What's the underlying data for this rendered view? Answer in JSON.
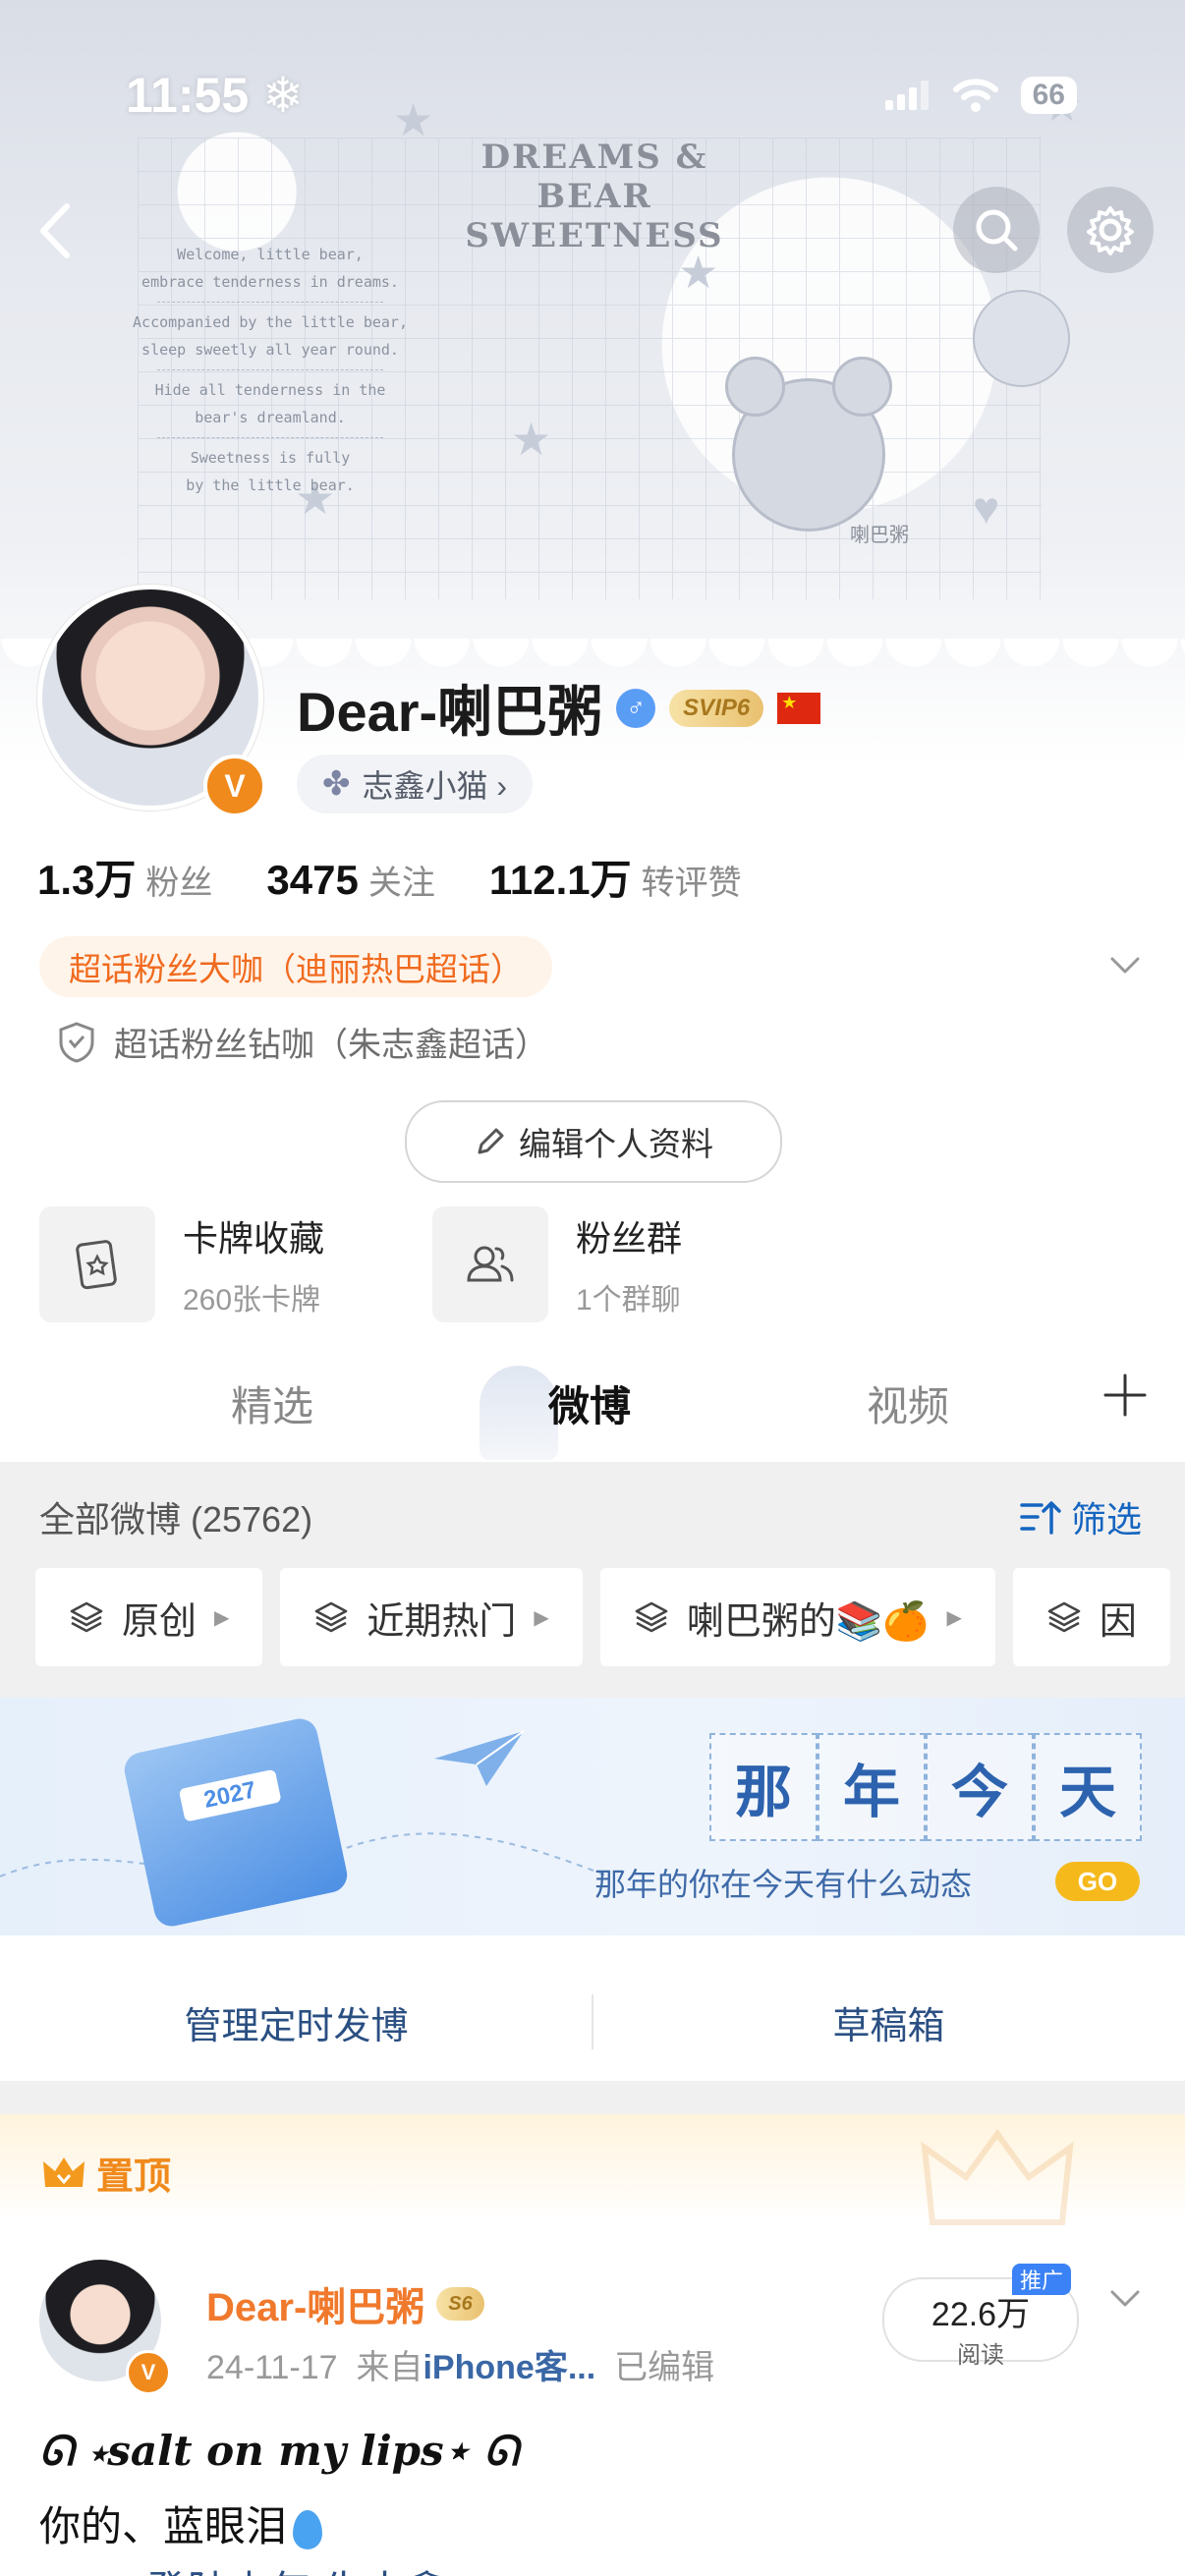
{
  "status_bar": {
    "time": "11:55",
    "battery": "66"
  },
  "banner": {
    "title_line1": "DREAMS & BEAR",
    "title_line2": "SWEETNESS",
    "poem": [
      "Welcome, little bear,",
      "embrace tenderness in dreams.",
      "Accompanied by the little bear,",
      "sleep sweetly all year round.",
      "Hide all tenderness in the",
      "bear's dreamland.",
      "Sweetness is fully",
      "by the little bear."
    ],
    "watermark": "喇巴粥"
  },
  "profile": {
    "name": "Dear-喇巴粥",
    "svip": "SVIP6",
    "tag": "志鑫小猫 ›",
    "stats": [
      {
        "value": "1.3万",
        "label": "粉丝"
      },
      {
        "value": "3475",
        "label": "关注"
      },
      {
        "value": "112.1万",
        "label": "转评赞"
      }
    ],
    "super_fan_orange": "超话粉丝大咖（迪丽热巴超话）",
    "super_fan_plain": "超话粉丝钻咖（朱志鑫超话）",
    "edit_button": "编辑个人资料"
  },
  "features": [
    {
      "title": "卡牌收藏",
      "sub": "260张卡牌"
    },
    {
      "title": "粉丝群",
      "sub": "1个群聊"
    }
  ],
  "tabs": [
    "精选",
    "微博",
    "视频"
  ],
  "feed_header": {
    "all": "全部微博 (25762)",
    "filter": "筛选"
  },
  "chips": [
    "原创",
    "近期热门",
    "喇巴粥的📚🍊",
    "因"
  ],
  "memory": {
    "boxes": [
      "那",
      "年",
      "今",
      "天"
    ],
    "subtitle": "那年的你在今天有什么动态",
    "go": "GO",
    "calendar_year": "2027"
  },
  "manage": {
    "scheduled": "管理定时发博",
    "drafts": "草稿箱"
  },
  "pinned": {
    "label": "置顶",
    "name": "Dear-喇巴粥",
    "badge": "S6",
    "date": "24-11-17",
    "source_prefix": "来自",
    "source": "iPhone客...",
    "edited": "已编辑",
    "reads": "22.6万",
    "reads_label": "阅读",
    "promo": "推广",
    "line1": "ᘏ ⋆salt on my lips⋆ ᘏ",
    "line2": "你的、蓝眼泪",
    "line3": "#TOP登陆少年 朱志鑫"
  }
}
